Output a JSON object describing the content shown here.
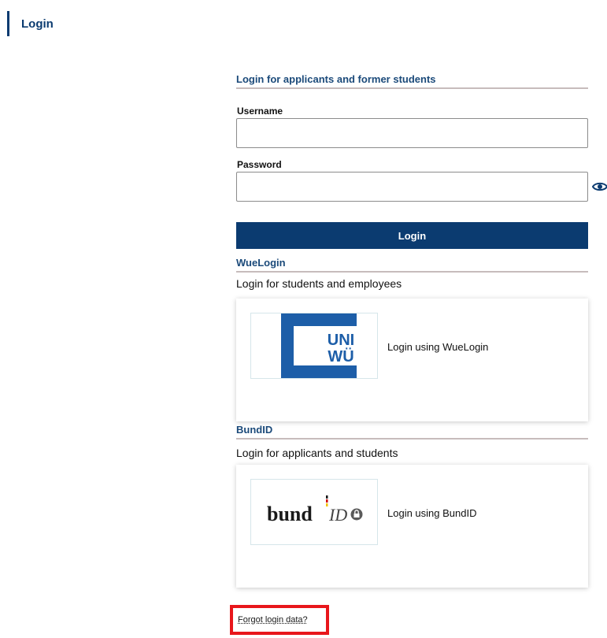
{
  "header": {
    "title": "Login"
  },
  "login_form": {
    "section_title": "Login for applicants and former students",
    "username_label": "Username",
    "username_value": "",
    "password_label": "Password",
    "password_value": "",
    "login_button_label": "Login"
  },
  "wuelogin": {
    "section_title": "WueLogin",
    "description": "Login for students and employees",
    "logo_text_line1": "UNI",
    "logo_text_line2": "WÜ",
    "card_label": "Login using WueLogin",
    "brand_color": "#1d5ea8"
  },
  "bundid": {
    "section_title": "BundID",
    "description": "Login for applicants and students",
    "logo_text": "bund",
    "logo_text_id": "ID",
    "card_label": "Login using BundID"
  },
  "forgot": {
    "link_label": "Forgot login data?"
  },
  "colors": {
    "primary": "#0b3b70",
    "highlight": "#e8161b"
  }
}
